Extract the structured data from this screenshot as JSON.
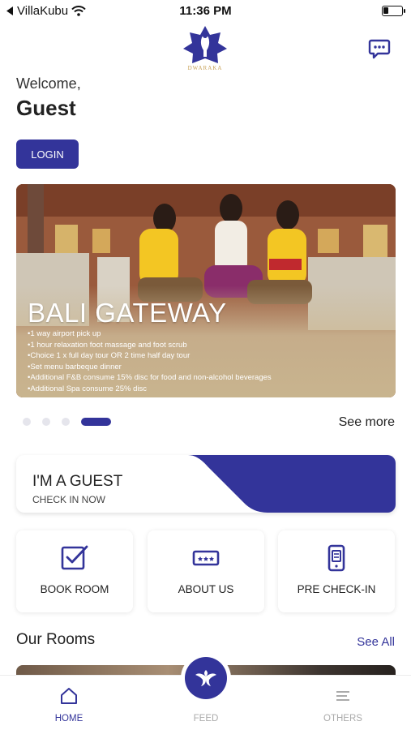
{
  "status_bar": {
    "carrier": "VillaKubu",
    "time": "11:36 PM",
    "battery_level": 0.3,
    "icons": [
      "back-arrow-icon",
      "wifi-icon",
      "battery-icon"
    ]
  },
  "header": {
    "logo_text": "DWARAKA",
    "chat_icon": "chat-bubble-icon"
  },
  "greeting": {
    "welcome": "Welcome,",
    "name": "Guest",
    "login_label": "LOGIN"
  },
  "banner": {
    "title": "BALI GATEWAY",
    "items": [
      "1 way airport pick up",
      "1 hour relaxation foot massage and foot scrub",
      "Choice 1 x full day tour OR 2 time half day tour",
      "Set menu barbeque dinner",
      "Additional F&B consume 15% disc for food and non-alcohol beverages",
      "Additional Spa consume 25% disc"
    ],
    "slide_count": 4,
    "active_slide": 4,
    "see_more": "See more"
  },
  "guest_card": {
    "title": "I'M A GUEST",
    "subtitle": "CHECK IN NOW"
  },
  "actions": [
    {
      "label": "BOOK ROOM",
      "icon": "checkbox-icon"
    },
    {
      "label": "ABOUT US",
      "icon": "ticket-icon"
    },
    {
      "label": "PRE CHECK-IN",
      "icon": "phone-icon"
    }
  ],
  "rooms": {
    "title": "Our Rooms",
    "see_all": "See All"
  },
  "tab_bar": {
    "tabs": [
      {
        "label": "HOME",
        "icon": "home-icon",
        "active": true
      },
      {
        "label": "FEED",
        "icon": "feed-logo-icon",
        "active": false
      },
      {
        "label": "OTHERS",
        "icon": "menu-icon",
        "active": false
      }
    ]
  },
  "colors": {
    "primary": "#33349a",
    "tab_inactive": "#aaaaaa",
    "logo_gold": "#c9a35a"
  }
}
